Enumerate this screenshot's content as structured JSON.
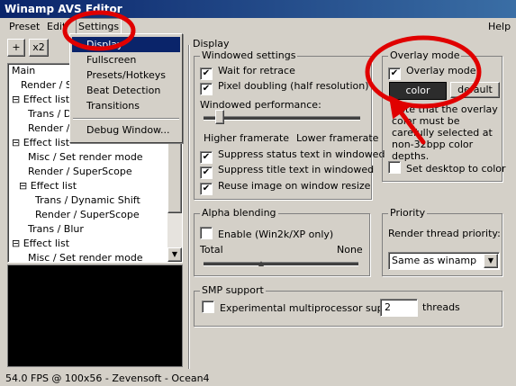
{
  "window": {
    "title": "Winamp AVS Editor"
  },
  "menu": {
    "preset": "Preset",
    "edit": "Edit",
    "settings": "Settings",
    "help": "Help"
  },
  "settings_menu": {
    "items": [
      "Display",
      "Fullscreen",
      "Presets/Hotkeys",
      "Beat Detection",
      "Transitions"
    ],
    "debug": "Debug Window..."
  },
  "toolbar": {
    "add": "+",
    "x2": "x2"
  },
  "tree": {
    "items": [
      "Main",
      "Render / S",
      "Effect list",
      "Trans / D",
      "Render /",
      "Effect list",
      "Misc / Set render mode",
      "Render / SuperScope",
      "Effect list",
      "Trans / Dynamic Shift",
      "Render / SuperScope",
      "Trans / Blur",
      "Effect list",
      "Misc / Set render mode"
    ]
  },
  "status": "54.0 FPS @ 100x56 - Zevensoft - Ocean4",
  "display": {
    "title": "Display",
    "windowed": {
      "title": "Windowed settings",
      "wait_retrace": "Wait for retrace",
      "pixel_doubling": "Pixel doubling (half resolution)",
      "perf_label": "Windowed performance:",
      "higher": "Higher framerate",
      "lower": "Lower framerate",
      "suppress_status": "Suppress status text in windowed",
      "suppress_title": "Suppress title text in windowed",
      "reuse_image": "Reuse image on window resize",
      "performance_level": 0.08
    },
    "overlay": {
      "title": "Overlay mode",
      "overlay_mode": "Overlay mode",
      "color_btn": "color",
      "default_btn": "default",
      "note": "Note that the overlay color must be carefully selected at non-32bpp color depths.",
      "set_desktop": "Set desktop to color"
    },
    "alpha": {
      "title": "Alpha blending",
      "enable": "Enable (Win2k/XP only)",
      "total": "Total",
      "none": "None",
      "level": 0.37
    },
    "priority": {
      "title": "Priority",
      "label": "Render thread priority:",
      "value": "Same as winamp"
    },
    "smp": {
      "title": "SMP support",
      "label": "Experimental multiprocessor support:",
      "threads_value": "2",
      "threads_label": "threads"
    }
  },
  "check": "✔"
}
